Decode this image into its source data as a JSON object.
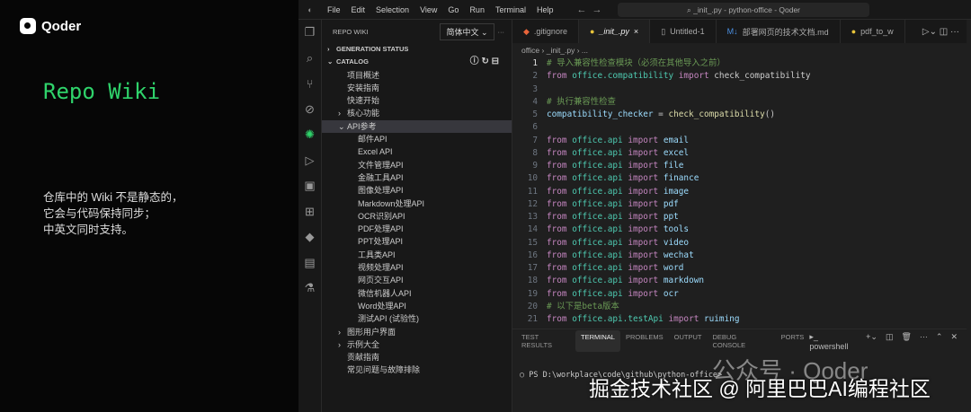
{
  "left": {
    "brand": "Qoder",
    "title": "Repo Wiki",
    "desc": [
      "仓库中的 Wiki 不是静态的，",
      "它会与代码保持同步；",
      "中英文同时支持。"
    ]
  },
  "titlebar": {
    "menus": [
      "File",
      "Edit",
      "Selection",
      "View",
      "Go",
      "Run",
      "Terminal",
      "Help"
    ],
    "search": "_init_.py - python-office - Qoder"
  },
  "sidebar": {
    "title": "REPO WIKI",
    "language": "简体中文",
    "items": [
      {
        "label": "GENERATION STATUS",
        "indent": 0,
        "arrow": "›",
        "sec": true
      },
      {
        "label": "CATALOG",
        "indent": 0,
        "arrow": "⌄",
        "sec": true
      },
      {
        "label": "项目概述",
        "indent": 1
      },
      {
        "label": "安装指南",
        "indent": 1
      },
      {
        "label": "快速开始",
        "indent": 1
      },
      {
        "label": "核心功能",
        "indent": 1,
        "arrow": "›"
      },
      {
        "label": "API参考",
        "indent": 1,
        "arrow": "⌄",
        "sel": true
      },
      {
        "label": "邮件API",
        "indent": 2
      },
      {
        "label": "Excel API",
        "indent": 2
      },
      {
        "label": "文件管理API",
        "indent": 2
      },
      {
        "label": "金融工具API",
        "indent": 2
      },
      {
        "label": "图像处理API",
        "indent": 2
      },
      {
        "label": "Markdown处理API",
        "indent": 2
      },
      {
        "label": "OCR识别API",
        "indent": 2
      },
      {
        "label": "PDF处理API",
        "indent": 2
      },
      {
        "label": "PPT处理API",
        "indent": 2
      },
      {
        "label": "工具类API",
        "indent": 2
      },
      {
        "label": "视频处理API",
        "indent": 2
      },
      {
        "label": "网页交互API",
        "indent": 2
      },
      {
        "label": "微信机器人API",
        "indent": 2
      },
      {
        "label": "Word处理API",
        "indent": 2
      },
      {
        "label": "测试API (试验性)",
        "indent": 2
      },
      {
        "label": "图形用户界面",
        "indent": 1,
        "arrow": "›"
      },
      {
        "label": "示例大全",
        "indent": 1,
        "arrow": "›"
      },
      {
        "label": "贡献指南",
        "indent": 1
      },
      {
        "label": "常见问题与故障排除",
        "indent": 1
      }
    ]
  },
  "tabs": [
    {
      "label": ".gitignore",
      "icon": "◆",
      "color": "#e8643a"
    },
    {
      "label": "_init_.py",
      "icon": "●",
      "color": "#e8c43a",
      "active": true,
      "close": "×"
    },
    {
      "label": "Untitled-1",
      "icon": "▯",
      "color": "#aaa"
    },
    {
      "label": "部署网页的技术文档.md",
      "icon": "M↓",
      "color": "#4a8fe0"
    },
    {
      "label": "pdf_to_w",
      "icon": "●",
      "color": "#e8c43a"
    }
  ],
  "breadcrumb": "office › _init_.py › ...",
  "code": [
    [
      [
        "cm",
        "# 导入兼容性检查模块（必须在其他导入之前）"
      ]
    ],
    [
      [
        "kw",
        "from "
      ],
      [
        "mod",
        "office.compatibility"
      ],
      [
        "kw",
        " import "
      ],
      [
        "pl",
        "check_compatibility"
      ]
    ],
    [],
    [
      [
        "cm",
        "# 执行兼容性检查"
      ]
    ],
    [
      [
        "nm",
        "compatibility_checker"
      ],
      [
        "pl",
        " = "
      ],
      [
        "fn",
        "check_compatibility"
      ],
      [
        "pl",
        "()"
      ]
    ],
    [],
    [
      [
        "kw",
        "from "
      ],
      [
        "mod",
        "office.api"
      ],
      [
        "kw",
        " import "
      ],
      [
        "nm",
        "email"
      ]
    ],
    [
      [
        "kw",
        "from "
      ],
      [
        "mod",
        "office.api"
      ],
      [
        "kw",
        " import "
      ],
      [
        "nm",
        "excel"
      ]
    ],
    [
      [
        "kw",
        "from "
      ],
      [
        "mod",
        "office.api"
      ],
      [
        "kw",
        " import "
      ],
      [
        "nm",
        "file"
      ]
    ],
    [
      [
        "kw",
        "from "
      ],
      [
        "mod",
        "office.api"
      ],
      [
        "kw",
        " import "
      ],
      [
        "nm",
        "finance"
      ]
    ],
    [
      [
        "kw",
        "from "
      ],
      [
        "mod",
        "office.api"
      ],
      [
        "kw",
        " import "
      ],
      [
        "nm",
        "image"
      ]
    ],
    [
      [
        "kw",
        "from "
      ],
      [
        "mod",
        "office.api"
      ],
      [
        "kw",
        " import "
      ],
      [
        "nm",
        "pdf"
      ]
    ],
    [
      [
        "kw",
        "from "
      ],
      [
        "mod",
        "office.api"
      ],
      [
        "kw",
        " import "
      ],
      [
        "nm",
        "ppt"
      ]
    ],
    [
      [
        "kw",
        "from "
      ],
      [
        "mod",
        "office.api"
      ],
      [
        "kw",
        " import "
      ],
      [
        "nm",
        "tools"
      ]
    ],
    [
      [
        "kw",
        "from "
      ],
      [
        "mod",
        "office.api"
      ],
      [
        "kw",
        " import "
      ],
      [
        "nm",
        "video"
      ]
    ],
    [
      [
        "kw",
        "from "
      ],
      [
        "mod",
        "office.api"
      ],
      [
        "kw",
        " import "
      ],
      [
        "nm",
        "wechat"
      ]
    ],
    [
      [
        "kw",
        "from "
      ],
      [
        "mod",
        "office.api"
      ],
      [
        "kw",
        " import "
      ],
      [
        "nm",
        "word"
      ]
    ],
    [
      [
        "kw",
        "from "
      ],
      [
        "mod",
        "office.api"
      ],
      [
        "kw",
        " import "
      ],
      [
        "nm",
        "markdown"
      ]
    ],
    [
      [
        "kw",
        "from "
      ],
      [
        "mod",
        "office.api"
      ],
      [
        "kw",
        " import "
      ],
      [
        "nm",
        "ocr"
      ]
    ],
    [
      [
        "cm",
        "# 以下是beta版本"
      ]
    ],
    [
      [
        "kw",
        "from "
      ],
      [
        "mod",
        "office.api.testApi"
      ],
      [
        "kw",
        " import "
      ],
      [
        "nm",
        "ruiming"
      ]
    ]
  ],
  "panel": {
    "tabs": [
      "TEST RESULTS",
      "TERMINAL",
      "PROBLEMS",
      "OUTPUT",
      "DEBUG CONSOLE",
      "PORTS"
    ],
    "active": 1,
    "shell": "powershell",
    "prompt": "○ PS D:\\workplace\\code\\github\\python-office>"
  },
  "watermark": {
    "wechat": "公众号 · Qoder",
    "caption": "掘金技术社区 @ 阿里巴巴AI编程社区"
  }
}
